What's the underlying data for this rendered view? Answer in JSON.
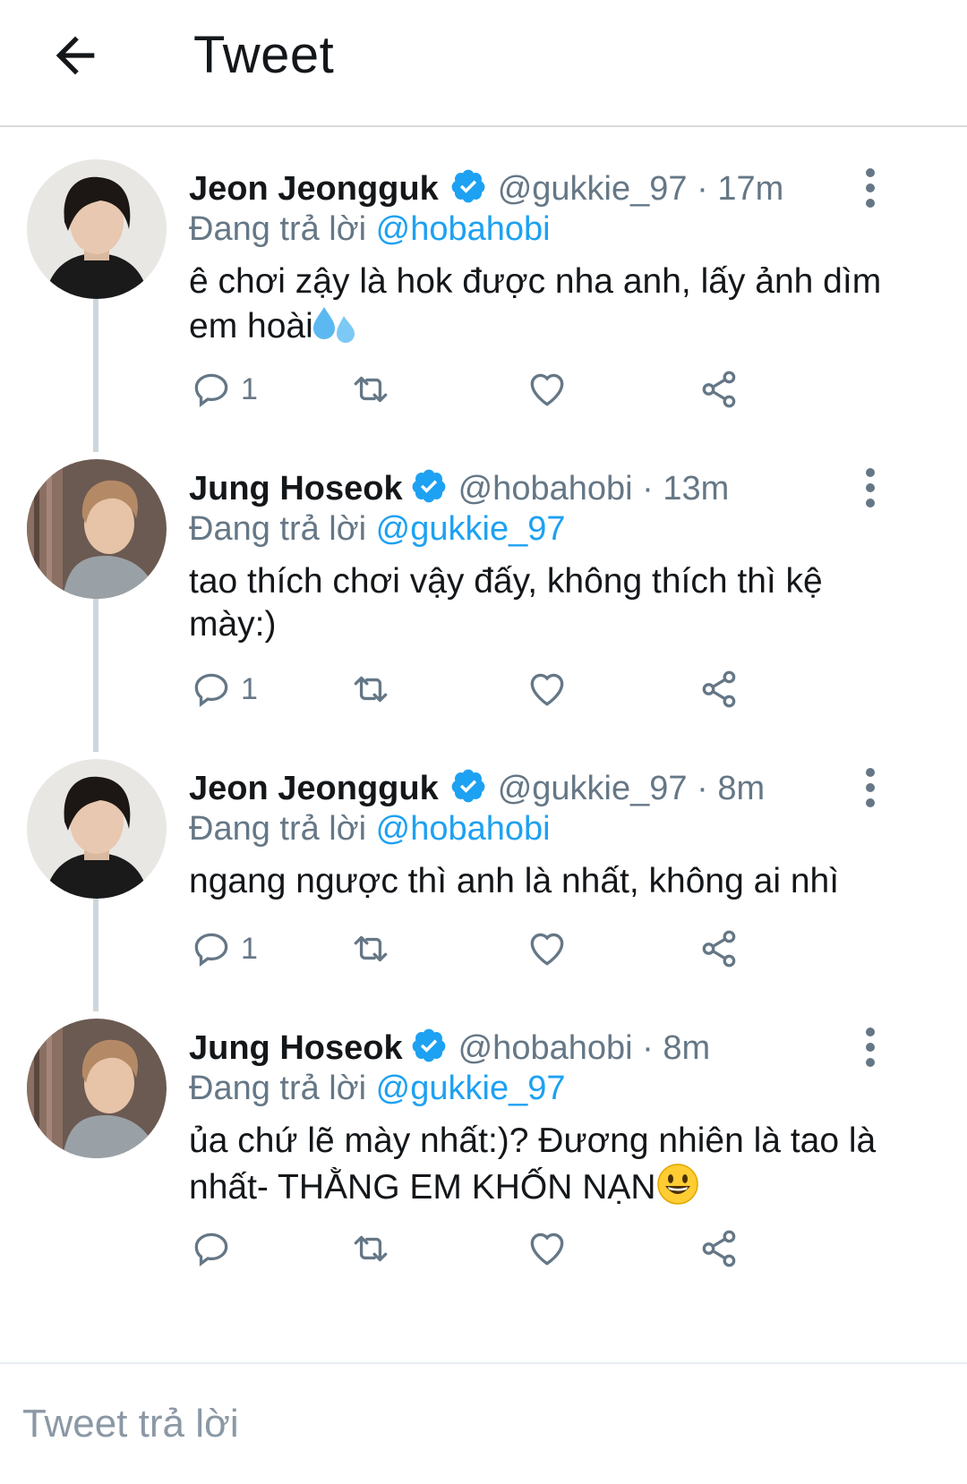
{
  "header": {
    "title": "Tweet"
  },
  "tweets": [
    {
      "name": "Jeon Jeongguk",
      "handle": "@gukkie_97",
      "separator": "·",
      "time": "17m",
      "reply_prefix": "Đang trả lời",
      "reply_to": "@hobahobi",
      "text": "ê chơi zậy là hok được nha anh, lấy ảnh dìm em hoài",
      "emoji": "sweat-droplets",
      "reply_count": "1"
    },
    {
      "name": "Jung Hoseok",
      "handle": "@hobahobi",
      "separator": "·",
      "time": "13m",
      "reply_prefix": "Đang trả lời",
      "reply_to": "@gukkie_97",
      "text": "tao thích chơi vậy đấy, không thích thì kệ mày:)",
      "emoji": "",
      "reply_count": "1"
    },
    {
      "name": "Jeon Jeongguk",
      "handle": "@gukkie_97",
      "separator": "·",
      "time": "8m",
      "reply_prefix": "Đang trả lời",
      "reply_to": "@hobahobi",
      "text": "ngang ngược thì anh là nhất, không ai nhì",
      "emoji": "",
      "reply_count": "1"
    },
    {
      "name": "Jung Hoseok",
      "handle": "@hobahobi",
      "separator": "·",
      "time": "8m",
      "reply_prefix": "Đang trả lời",
      "reply_to": "@gukkie_97",
      "text": "ủa chứ lẽ mày nhất:)? Đương nhiên là tao là nhất- THẰNG EM KHỐN NẠN",
      "emoji": "grinning-face",
      "reply_count": ""
    }
  ],
  "reply_bar": {
    "placeholder": "Tweet trả lời"
  },
  "colors": {
    "accent": "#1da1f2",
    "muted": "#657786",
    "thread": "#ccd6dd"
  }
}
